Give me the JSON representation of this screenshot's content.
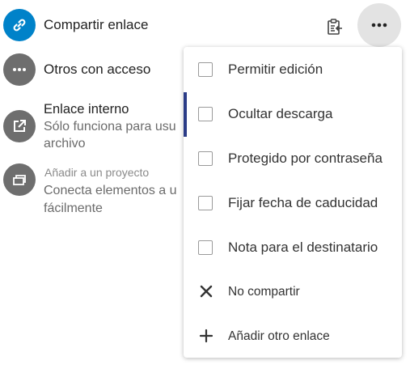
{
  "rows": {
    "share_link": {
      "title": "Compartir enlace",
      "icon": "link-icon",
      "color": "#0082c9"
    },
    "others_access": {
      "title": "Otros con acceso",
      "icon": "more-icon",
      "color": "#6e6e6e"
    },
    "internal_link": {
      "title": "Enlace interno",
      "subtitle_line1": "Sólo funciona para usu",
      "subtitle_line2": "archivo",
      "icon": "external-link-icon",
      "color": "#6e6e6e"
    },
    "project": {
      "label": "Añadir a un proyecto",
      "subtitle_line1": "Conecta elementos a u",
      "subtitle_line2": "fácilmente",
      "icon": "projects-icon",
      "color": "#6e6e6e"
    }
  },
  "toolbar": {
    "copy_icon": "clipboard-icon",
    "more_icon": "ellipsis-icon"
  },
  "menu": {
    "items": [
      {
        "label": "Permitir edición",
        "type": "checkbox",
        "checked": false
      },
      {
        "label": "Ocultar descarga",
        "type": "checkbox",
        "checked": false,
        "active": true
      },
      {
        "label": "Protegido por contraseña",
        "type": "checkbox",
        "checked": false
      },
      {
        "label": "Fijar fecha de caducidad",
        "type": "checkbox",
        "checked": false
      },
      {
        "label": "Nota para el destinatario",
        "type": "checkbox",
        "checked": false
      },
      {
        "label": "No compartir",
        "type": "action",
        "icon": "close-icon"
      },
      {
        "label": "Añadir otro enlace",
        "type": "action",
        "icon": "plus-icon"
      }
    ]
  },
  "colors": {
    "accent": "#2b3c87"
  }
}
